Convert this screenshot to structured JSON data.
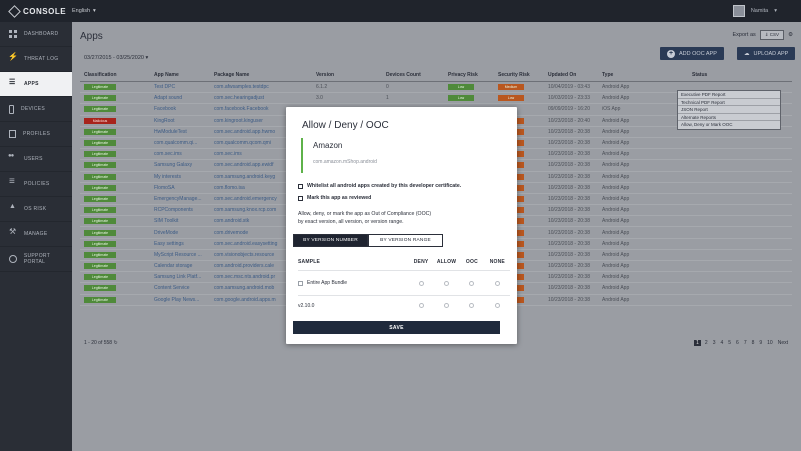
{
  "app": {
    "logo_text": "CONSOLE",
    "language": "English",
    "user": "Namita"
  },
  "sidebar": {
    "items": [
      {
        "label": "DASHBOARD",
        "icon": "grid-icon"
      },
      {
        "label": "THREAT LOG",
        "icon": "bolt-icon"
      },
      {
        "label": "APPS",
        "icon": "apps-icon"
      },
      {
        "label": "DEVICES",
        "icon": "phone-icon"
      },
      {
        "label": "PROFILES",
        "icon": "document-icon"
      },
      {
        "label": "USERS",
        "icon": "users-icon"
      },
      {
        "label": "POLICIES",
        "icon": "list-icon"
      },
      {
        "label": "OS RISK",
        "icon": "warning-icon"
      },
      {
        "label": "MANAGE",
        "icon": "wrench-icon"
      },
      {
        "label": "SUPPORT PORTAL",
        "icon": "circle-icon"
      }
    ]
  },
  "header": {
    "title": "Apps",
    "date_range": "03/27/2015 - 03/25/2020",
    "export_label": "Export as",
    "export_format": "CSV",
    "add_ooc_label": "ADD OOC APP",
    "upload_label": "UPLOAD APP"
  },
  "table": {
    "columns": [
      "Classification",
      "App Name",
      "Package Name",
      "Version",
      "Devices Count",
      "Privacy Risk",
      "Security Risk",
      "Updated On",
      "Type",
      "Status"
    ],
    "rows": [
      {
        "cls": "Legitimate",
        "mal": false,
        "name": "Test DPC",
        "pkg": "com.afwsamples.testdpc",
        "ver": "6.1.2",
        "count": "0",
        "priv": "Low",
        "sec": "Medium",
        "upd": "10/04/2019 - 03:43",
        "type": "Android App"
      },
      {
        "cls": "Legitimate",
        "mal": false,
        "name": "Adapt sound",
        "pkg": "com.sec.hearingadjust",
        "ver": "3.0",
        "count": "1",
        "priv": "Low",
        "sec": "Low",
        "upd": "10/03/2019 - 23:33",
        "type": "Android App"
      },
      {
        "cls": "Legitimate",
        "mal": false,
        "name": "Facebook",
        "pkg": "com.facebook.Facebook",
        "ver": "",
        "count": "",
        "priv": "",
        "sec": "",
        "upd": "09/09/2019 - 16:20",
        "type": "iOS App"
      },
      {
        "cls": "Malicious",
        "mal": true,
        "name": "KingRoot",
        "pkg": "com.kingroot.kinguser",
        "ver": "",
        "count": "",
        "priv": "",
        "sec": "High",
        "upd": "10/23/2018 - 20:40",
        "type": "Android App"
      },
      {
        "cls": "Legitimate",
        "mal": false,
        "name": "HwModuleTest",
        "pkg": "com.sec.android.app.hwmo",
        "ver": "",
        "count": "",
        "priv": "",
        "sec": "High",
        "upd": "10/23/2018 - 20:38",
        "type": "Android App"
      },
      {
        "cls": "Legitimate",
        "mal": false,
        "name": "com.qualcomm.qi...",
        "pkg": "com.qualcomm.qcom.qmi",
        "ver": "",
        "count": "",
        "priv": "",
        "sec": "High",
        "upd": "10/23/2018 - 20:38",
        "type": "Android App"
      },
      {
        "cls": "Legitimate",
        "mal": false,
        "name": "com.sec.ims",
        "pkg": "com.sec.ims",
        "ver": "",
        "count": "",
        "priv": "",
        "sec": "High",
        "upd": "10/23/2018 - 20:38",
        "type": "Android App"
      },
      {
        "cls": "Legitimate",
        "mal": false,
        "name": "Samsung Galaxy",
        "pkg": "com.sec.android.app.ewidf",
        "ver": "",
        "count": "",
        "priv": "",
        "sec": "Medium",
        "upd": "10/23/2018 - 20:38",
        "type": "Android App"
      },
      {
        "cls": "Legitimate",
        "mal": false,
        "name": "My interests",
        "pkg": "com.samsung.android.keyg",
        "ver": "",
        "count": "",
        "priv": "",
        "sec": "Low",
        "upd": "10/23/2018 - 20:38",
        "type": "Android App"
      },
      {
        "cls": "Legitimate",
        "mal": false,
        "name": "FlomoSA",
        "pkg": "com.flomo.isa",
        "ver": "",
        "count": "",
        "priv": "",
        "sec": "Low",
        "upd": "10/23/2018 - 20:38",
        "type": "Android App"
      },
      {
        "cls": "Legitimate",
        "mal": false,
        "name": "EmergencyManage...",
        "pkg": "com.sec.android.emergency",
        "ver": "",
        "count": "",
        "priv": "",
        "sec": "High",
        "upd": "10/23/2018 - 20:38",
        "type": "Android App"
      },
      {
        "cls": "Legitimate",
        "mal": false,
        "name": "RCPComponents",
        "pkg": "com.samsung.knox.rcp.com",
        "ver": "",
        "count": "",
        "priv": "",
        "sec": "High",
        "upd": "10/23/2018 - 20:38",
        "type": "Android App"
      },
      {
        "cls": "Legitimate",
        "mal": false,
        "name": "SIM Toolkit",
        "pkg": "com.android.stk",
        "ver": "",
        "count": "",
        "priv": "",
        "sec": "High",
        "upd": "10/23/2018 - 20:38",
        "type": "Android App"
      },
      {
        "cls": "Legitimate",
        "mal": false,
        "name": "DriveMode",
        "pkg": "com.drivemode",
        "ver": "",
        "count": "",
        "priv": "",
        "sec": "High",
        "upd": "10/23/2018 - 20:38",
        "type": "Android App"
      },
      {
        "cls": "Legitimate",
        "mal": false,
        "name": "Easy settings",
        "pkg": "com.sec.android.easysetting",
        "ver": "",
        "count": "",
        "priv": "",
        "sec": "Low",
        "upd": "10/23/2018 - 20:38",
        "type": "Android App"
      },
      {
        "cls": "Legitimate",
        "mal": false,
        "name": "MyScript Resource ...",
        "pkg": "com.visionobjects.resource",
        "ver": "",
        "count": "",
        "priv": "",
        "sec": "Low",
        "upd": "10/23/2018 - 20:38",
        "type": "Android App"
      },
      {
        "cls": "Legitimate",
        "mal": false,
        "name": "Calendar storage",
        "pkg": "com.android.providers.cale",
        "ver": "",
        "count": "",
        "priv": "",
        "sec": "High",
        "upd": "10/23/2018 - 20:38",
        "type": "Android App"
      },
      {
        "cls": "Legitimate",
        "mal": false,
        "name": "Samsung Link Platf...",
        "pkg": "com.sec.msc.nts.android.pr",
        "ver": "",
        "count": "",
        "priv": "",
        "sec": "High",
        "upd": "10/23/2018 - 20:38",
        "type": "Android App"
      },
      {
        "cls": "Legitimate",
        "mal": false,
        "name": "Content Service",
        "pkg": "com.samsung.android.mob",
        "ver": "",
        "count": "",
        "priv": "",
        "sec": "High",
        "upd": "10/23/2018 - 20:38",
        "type": "Android App"
      },
      {
        "cls": "Legitimate",
        "mal": false,
        "name": "Google Play News...",
        "pkg": "com.google.android.apps.m",
        "ver": "",
        "count": "",
        "priv": "",
        "sec": "Low",
        "upd": "10/23/2018 - 20:38",
        "type": "Android App"
      }
    ],
    "pager_text": "1 - 20 of 558",
    "pages": [
      "1",
      "2",
      "3",
      "4",
      "5",
      "6",
      "7",
      "8",
      "9",
      "10",
      "Next"
    ]
  },
  "context_menu": {
    "items": [
      "Executive PDF Report",
      "Technical PDF Report",
      "JSON Report",
      "Alternate Reports",
      "Allow, Deny or Mark OOC"
    ]
  },
  "modal": {
    "title": "Allow / Deny / OOC",
    "app_name": "Amazon",
    "package": "com.amazon.mShop.android",
    "check1": "Whitelist all android apps created by this developer certificate.",
    "check2": "Mark this app as reviewed",
    "desc_line1": "Allow, deny, or mark the app as Out of Compliance (OOC)",
    "desc_line2": "by exact version, all version, or version range.",
    "tab_active": "BY VERSION NUMBER",
    "tab_idle": "BY VERSION RANGE",
    "col_sample": "SAMPLE",
    "col_deny": "DENY",
    "col_allow": "ALLOW",
    "col_ooc": "OOC",
    "col_none": "NONE",
    "row1": "Entire App Bundle",
    "row2": "v2.10.0",
    "save": "SAVE"
  }
}
